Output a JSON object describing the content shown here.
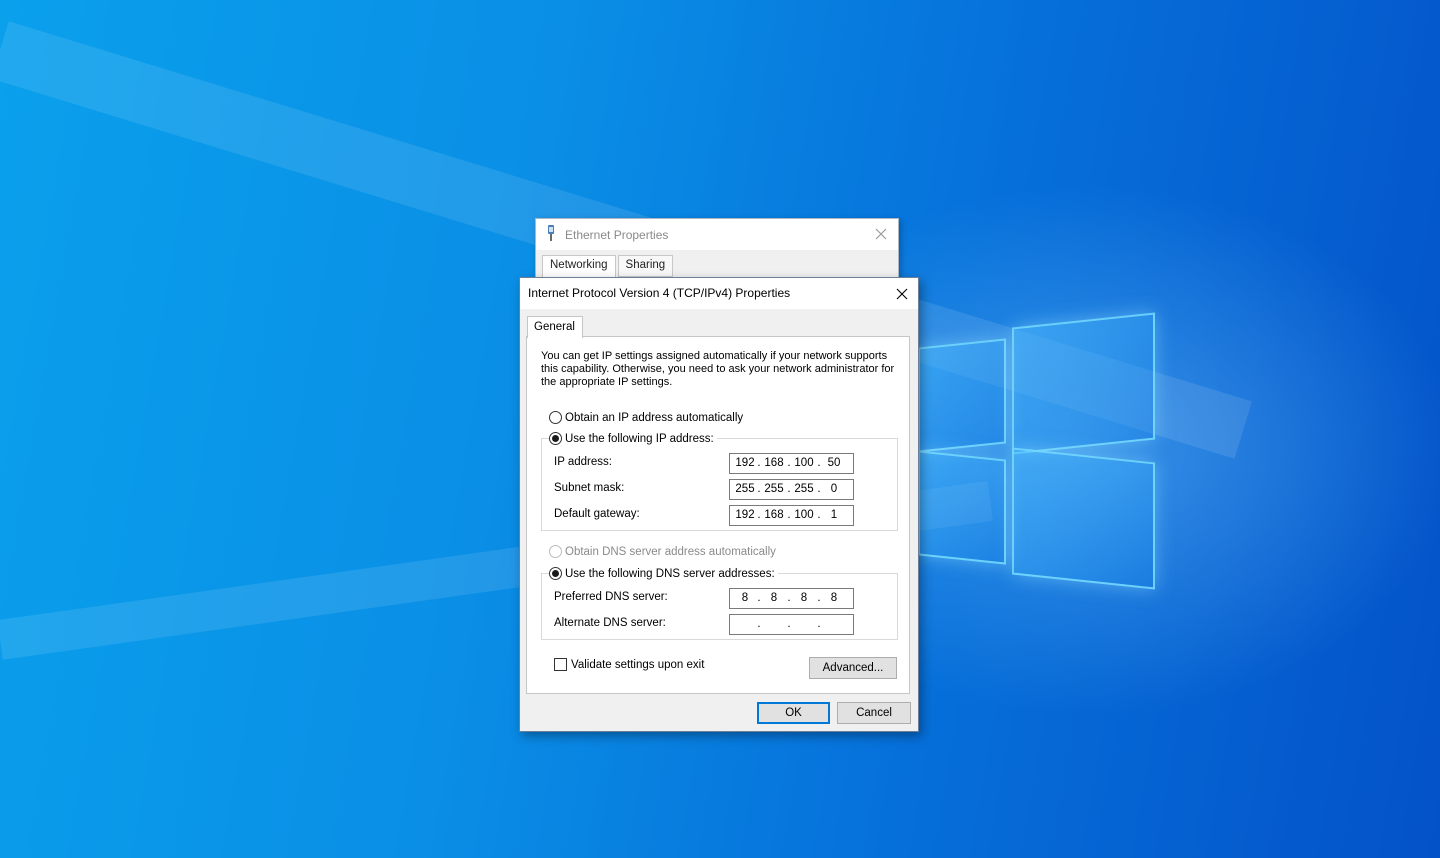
{
  "background_window": {
    "title": "Ethernet Properties",
    "tabs": [
      "Networking",
      "Sharing"
    ]
  },
  "dialog": {
    "title": "Internet Protocol Version 4 (TCP/IPv4) Properties",
    "tab": "General",
    "intro": "You can get IP settings assigned automatically if your network supports this capability. Otherwise, you need to ask your network administrator for the appropriate IP settings.",
    "ip": {
      "auto_label": "Obtain an IP address automatically",
      "auto_selected": false,
      "manual_label": "Use the following IP address:",
      "manual_selected": true,
      "ip_address_label": "IP address:",
      "ip_address": [
        "192",
        "168",
        "100",
        "50"
      ],
      "subnet_label": "Subnet mask:",
      "subnet": [
        "255",
        "255",
        "255",
        "0"
      ],
      "gateway_label": "Default gateway:",
      "gateway": [
        "192",
        "168",
        "100",
        "1"
      ]
    },
    "dns": {
      "auto_label": "Obtain DNS server address automatically",
      "auto_enabled": false,
      "manual_label": "Use the following DNS server addresses:",
      "manual_selected": true,
      "preferred_label": "Preferred DNS server:",
      "preferred": [
        "8",
        "8",
        "8",
        "8"
      ],
      "alternate_label": "Alternate DNS server:",
      "alternate": [
        "",
        "",
        "",
        ""
      ]
    },
    "validate_label": "Validate settings upon exit",
    "validate_checked": false,
    "advanced_label": "Advanced...",
    "ok_label": "OK",
    "cancel_label": "Cancel"
  },
  "colors": {
    "desktop_blue": "#0a8fe6",
    "accent": "#0078d7"
  }
}
